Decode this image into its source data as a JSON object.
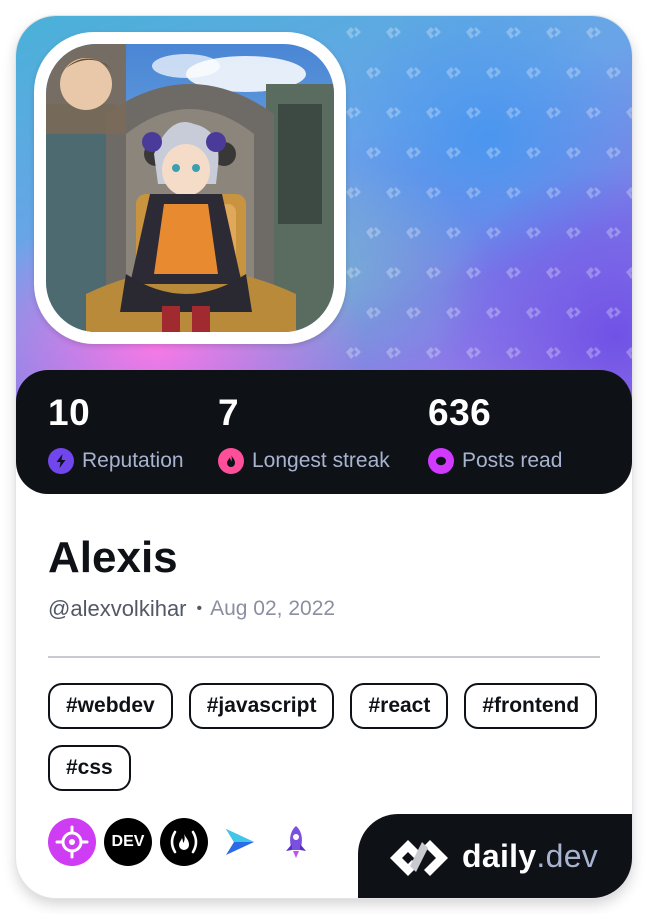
{
  "profile": {
    "name": "Alexis",
    "handle": "@alexvolkihar",
    "separator": "•",
    "joined": "Aug 02, 2022"
  },
  "stats": [
    {
      "value": "10",
      "label": "Reputation",
      "icon": "bolt-icon",
      "color": "#7147ed"
    },
    {
      "value": "7",
      "label": "Longest streak",
      "icon": "flame-icon",
      "color": "#ff4f9a"
    },
    {
      "value": "636",
      "label": "Posts read",
      "icon": "eye-icon",
      "color": "#d239ff"
    }
  ],
  "tags": [
    "#webdev",
    "#javascript",
    "#react",
    "#frontend",
    "#css"
  ],
  "sources": [
    {
      "icon": "crosshair-icon",
      "color": "#ce3df3"
    },
    {
      "icon": "dev-to-icon",
      "label": "DEV",
      "color": "#000000"
    },
    {
      "icon": "freecodecamp-icon",
      "label": "(🔥)",
      "color": "#000000"
    },
    {
      "icon": "arrow-play-icon",
      "color": "#2c6be8"
    },
    {
      "icon": "rocket-icon",
      "color": "#6c3fd8"
    }
  ],
  "brand": {
    "name": "daily",
    "tld": ".dev"
  }
}
